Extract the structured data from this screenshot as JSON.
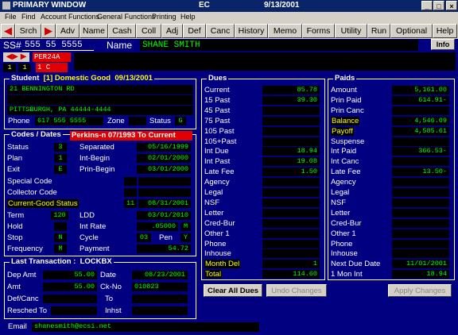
{
  "window": {
    "app": "PRIMARY WINDOW",
    "code": "EC",
    "date": "9/13/2001"
  },
  "menu": [
    "File",
    "Find",
    "Account Functions",
    "General Functions",
    "Printing",
    "Help"
  ],
  "toolbar": [
    "Srch",
    "Adv",
    "Name",
    "Cash",
    "Coll",
    "Adj",
    "Def",
    "Canc",
    "History",
    "Memo",
    "Forms",
    "Utility",
    "Run",
    "Optional",
    "Help"
  ],
  "header": {
    "ssn_label": "SS#",
    "ssn": "555 55 5555",
    "name_label": "Name",
    "name": "SHANE SMITH",
    "info": "Info"
  },
  "nav": {
    "code": "PER24A",
    "sub": "1 C",
    "page_a": "1",
    "page_b": "1"
  },
  "student": {
    "title": "Student",
    "bracket": "[1]",
    "status": "Domestic Good",
    "date": "09/13/2001",
    "address1": "21 BENNINGTON RD",
    "address2": "",
    "city": "PITTSBURGH, PA 44444-4444",
    "phone_label": "Phone",
    "phone": "617 555 5555",
    "zone_label": "Zone",
    "zone": "",
    "status_label": "Status",
    "status_val": "G"
  },
  "codes": {
    "title": "Codes / Dates",
    "banner": "Perkins-n 07/1993 To Current",
    "status_label": "Status",
    "status": "3",
    "separated_label": "Separated",
    "separated": "05/16/1999",
    "plan_label": "Plan",
    "plan": "1",
    "int_begin_label": "Int-Begin",
    "int_begin": "02/01/2000",
    "exit_label": "Exit",
    "exit": "E",
    "prin_begin_label": "Prin-Begin",
    "prin_begin": "03/01/2000",
    "special_label": "Special Code",
    "collector_label": "Collector Code",
    "current_label": "Current-Good Status",
    "current_code": "11",
    "current_date": "08/31/2001",
    "term_label": "Term",
    "term": "120",
    "ldd_label": "LDD",
    "ldd": "03/01/2010",
    "hold_label": "Hold",
    "hold": "",
    "int_rate_label": "Int Rate",
    "int_rate": ".05000",
    "int_rate_flag": "M",
    "stop_label": "Stop",
    "stop": "N",
    "cycle_label": "Cycle",
    "cycle": "03",
    "pen_label": "Pen",
    "pen": "Y",
    "freq_label": "Frequency",
    "freq": "M",
    "payment_label": "Payment",
    "payment": "54.72"
  },
  "last_txn": {
    "title": "Last Transaction :",
    "type": "LOCKBX",
    "dep_amt_label": "Dep Amt",
    "dep_amt": "55.00",
    "date_label": "Date",
    "date": "08/23/2001",
    "amt_label": "Amt",
    "amt": "55.00",
    "ck_label": "Ck-No",
    "ck": "010823",
    "defcanc_label": "Def/Canc",
    "to_label": "To",
    "resched_label": "Resched To",
    "inhouse_label": "Inhst"
  },
  "email": {
    "label": "Email",
    "value": "shanesmith@ecsi.net"
  },
  "dues": {
    "title": "Dues",
    "rows": [
      {
        "label": "Current",
        "value": "85.78"
      },
      {
        "label": "15 Past",
        "value": "39.30"
      },
      {
        "label": "45 Past",
        "value": ""
      },
      {
        "label": "75 Past",
        "value": ""
      },
      {
        "label": "105 Past",
        "value": ""
      },
      {
        "label": "105+Past",
        "value": ""
      },
      {
        "label": "Int Due",
        "value": "18.94"
      },
      {
        "label": "Int Past",
        "value": "19.08"
      },
      {
        "label": "Late Fee",
        "value": "1.50"
      },
      {
        "label": "Agency",
        "value": ""
      },
      {
        "label": "Legal",
        "value": ""
      },
      {
        "label": "NSF",
        "value": ""
      },
      {
        "label": "Letter",
        "value": ""
      },
      {
        "label": "Cred-Bur",
        "value": ""
      },
      {
        "label": "Other 1",
        "value": ""
      },
      {
        "label": "Phone",
        "value": ""
      },
      {
        "label": "Inhouse",
        "value": ""
      },
      {
        "label": "Month Del",
        "value": "1"
      },
      {
        "label": "Total",
        "value": "114.60"
      }
    ]
  },
  "paids": {
    "title": "Paids",
    "rows": [
      {
        "label": "Amount",
        "value": "5,161.00"
      },
      {
        "label": "Prin Paid",
        "value": "614.91-"
      },
      {
        "label": "Prin Canc",
        "value": ""
      },
      {
        "label": "Balance",
        "value": "4,546.09"
      },
      {
        "label": "Payoff",
        "value": "4,585.61"
      },
      {
        "label": "Suspense",
        "value": ""
      },
      {
        "label": "Int Paid",
        "value": "366.53-"
      },
      {
        "label": "Int Canc",
        "value": ""
      },
      {
        "label": "Late Fee",
        "value": "13.50-"
      },
      {
        "label": "Agency",
        "value": ""
      },
      {
        "label": "Legal",
        "value": ""
      },
      {
        "label": "NSF",
        "value": ""
      },
      {
        "label": "Letter",
        "value": ""
      },
      {
        "label": "Cred-Bur",
        "value": ""
      },
      {
        "label": "Other 1",
        "value": ""
      },
      {
        "label": "Phone",
        "value": ""
      },
      {
        "label": "Inhouse",
        "value": ""
      },
      {
        "label": "Next Due Date",
        "value": "11/01/2001"
      },
      {
        "label": "1 Mon Int",
        "value": "18.94"
      }
    ]
  },
  "buttons": {
    "clear": "Clear All Dues",
    "undo": "Undo Changes",
    "apply": "Apply Changes"
  },
  "colors": {
    "bg": "#000080",
    "field": "#000000",
    "text_green": "#00ff00",
    "accent_red": "#e00000",
    "highlight": "#ffff00"
  }
}
